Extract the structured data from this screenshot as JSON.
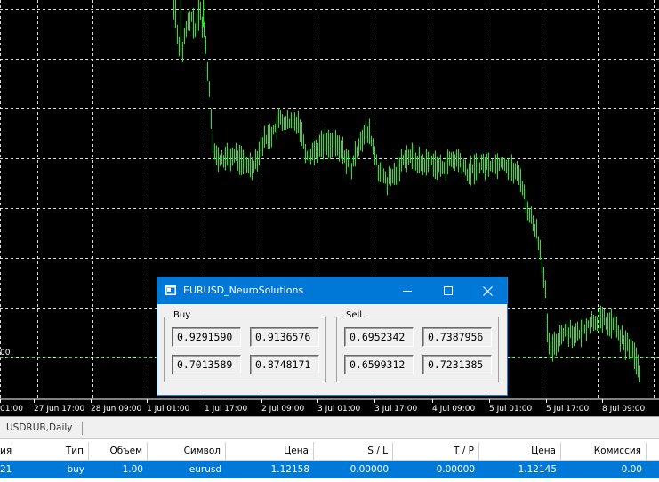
{
  "chart": {
    "background": "#000000",
    "candle_color": "#00ff00",
    "grid_color": "#ffffff",
    "price_label": "00",
    "time_labels": [
      "01:00",
      "27 Jun 17:00",
      "28 Jun 09:00",
      "1 Jul 01:00",
      "1 Jul 17:00",
      "2 Jul 09:00",
      "3 Jul 01:00",
      "3 Jul 17:00",
      "4 Jul 09:00",
      "5 Jul 01:00",
      "5 Jul 17:00",
      "8 Jul 09:00"
    ]
  },
  "dialog": {
    "title": "EURUSD_NeuroSolutions",
    "buy": {
      "label": "Buy",
      "values": [
        "0.9291590",
        "0.9136576",
        "0.7013589",
        "0.8748171"
      ]
    },
    "sell": {
      "label": "Sell",
      "values": [
        "0.6952342",
        "0.7387956",
        "0.6599312",
        "0.7231385"
      ]
    }
  },
  "toolbox": {
    "tab_label": "USDRUB,Daily",
    "columns": [
      "ия",
      "Тип",
      "Объем",
      "Символ",
      "Цена",
      "S / L",
      "T / P",
      "Цена",
      "Комиссия"
    ],
    "row": [
      "21",
      "buy",
      "1.00",
      "eurusd",
      "1.12158",
      "0.00000",
      "0.00000",
      "1.12145",
      "0.00"
    ],
    "selected_row_color": "#0078d7"
  }
}
